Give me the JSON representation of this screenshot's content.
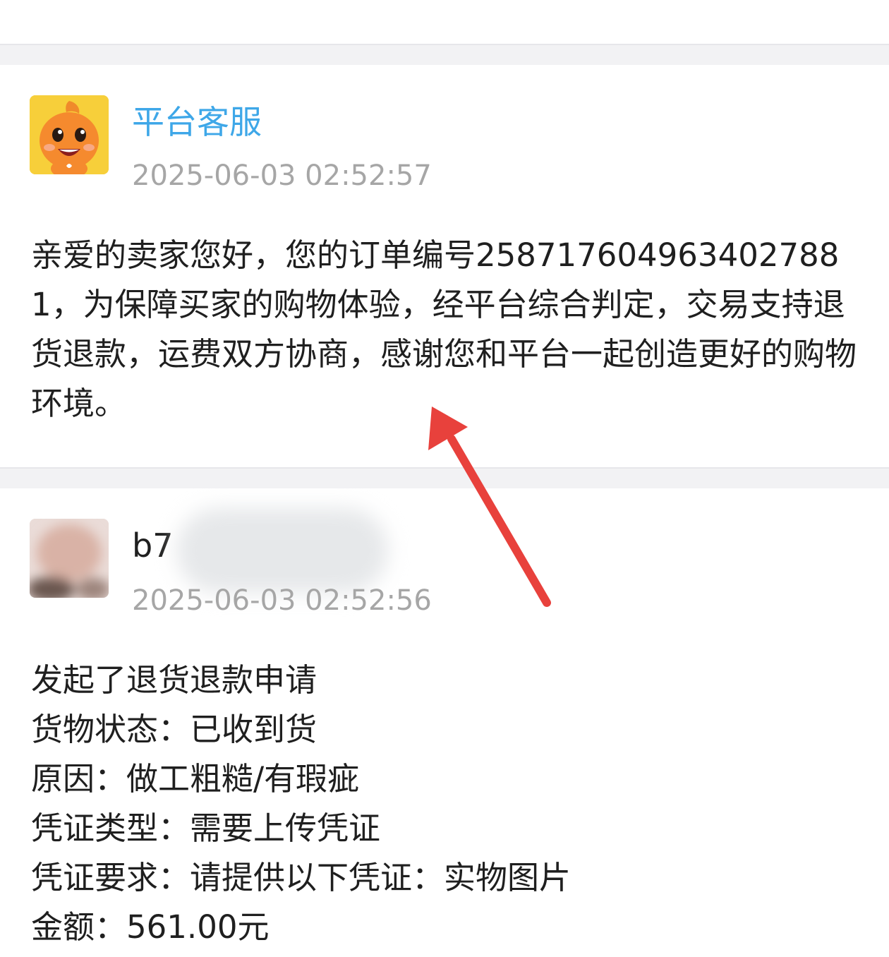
{
  "messages": [
    {
      "sender": "平台客服",
      "time": "2025-06-03 02:52:57",
      "text": "亲爱的卖家您好，您的订单编号2587176049634027881，为保障买家的购物体验，经平台综合判定，交易支持退货退款，运费双方协商，感谢您和平台一起创造更好的购物环境。",
      "avatar_icon": "orange-mascot-icon",
      "name_color": "#3ea7e8"
    },
    {
      "sender": "b7",
      "time": "2025-06-03 02:52:56",
      "avatar_icon": "blurred-user-avatar",
      "lines": [
        "发起了退货退款申请",
        "货物状态：已收到货",
        "原因：做工粗糙/有瑕疵",
        "凭证类型：需要上传凭证",
        "凭证要求：请提供以下凭证：实物图片",
        "金额：561.00元"
      ]
    }
  ],
  "annotation": {
    "icon": "red-arrow-annotation",
    "color": "#e8413c"
  }
}
